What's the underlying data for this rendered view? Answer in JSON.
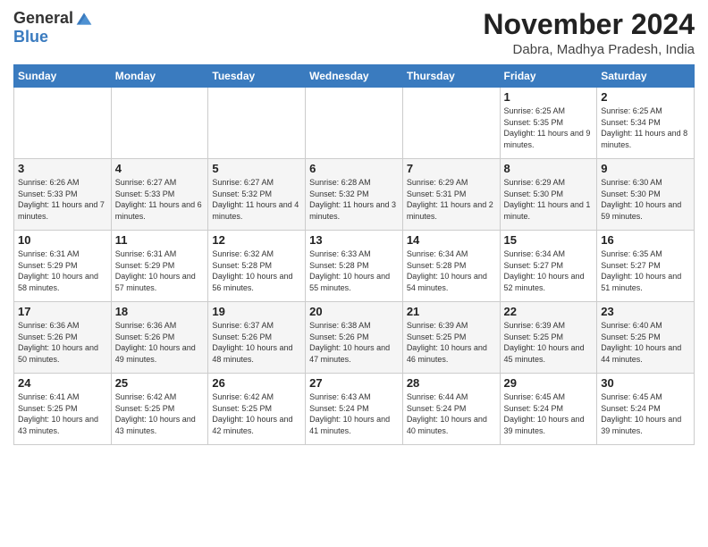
{
  "header": {
    "logo_general": "General",
    "logo_blue": "Blue",
    "month_year": "November 2024",
    "location": "Dabra, Madhya Pradesh, India"
  },
  "weekdays": [
    "Sunday",
    "Monday",
    "Tuesday",
    "Wednesday",
    "Thursday",
    "Friday",
    "Saturday"
  ],
  "weeks": [
    [
      {
        "day": "",
        "info": ""
      },
      {
        "day": "",
        "info": ""
      },
      {
        "day": "",
        "info": ""
      },
      {
        "day": "",
        "info": ""
      },
      {
        "day": "",
        "info": ""
      },
      {
        "day": "1",
        "info": "Sunrise: 6:25 AM\nSunset: 5:35 PM\nDaylight: 11 hours and 9 minutes."
      },
      {
        "day": "2",
        "info": "Sunrise: 6:25 AM\nSunset: 5:34 PM\nDaylight: 11 hours and 8 minutes."
      }
    ],
    [
      {
        "day": "3",
        "info": "Sunrise: 6:26 AM\nSunset: 5:33 PM\nDaylight: 11 hours and 7 minutes."
      },
      {
        "day": "4",
        "info": "Sunrise: 6:27 AM\nSunset: 5:33 PM\nDaylight: 11 hours and 6 minutes."
      },
      {
        "day": "5",
        "info": "Sunrise: 6:27 AM\nSunset: 5:32 PM\nDaylight: 11 hours and 4 minutes."
      },
      {
        "day": "6",
        "info": "Sunrise: 6:28 AM\nSunset: 5:32 PM\nDaylight: 11 hours and 3 minutes."
      },
      {
        "day": "7",
        "info": "Sunrise: 6:29 AM\nSunset: 5:31 PM\nDaylight: 11 hours and 2 minutes."
      },
      {
        "day": "8",
        "info": "Sunrise: 6:29 AM\nSunset: 5:30 PM\nDaylight: 11 hours and 1 minute."
      },
      {
        "day": "9",
        "info": "Sunrise: 6:30 AM\nSunset: 5:30 PM\nDaylight: 10 hours and 59 minutes."
      }
    ],
    [
      {
        "day": "10",
        "info": "Sunrise: 6:31 AM\nSunset: 5:29 PM\nDaylight: 10 hours and 58 minutes."
      },
      {
        "day": "11",
        "info": "Sunrise: 6:31 AM\nSunset: 5:29 PM\nDaylight: 10 hours and 57 minutes."
      },
      {
        "day": "12",
        "info": "Sunrise: 6:32 AM\nSunset: 5:28 PM\nDaylight: 10 hours and 56 minutes."
      },
      {
        "day": "13",
        "info": "Sunrise: 6:33 AM\nSunset: 5:28 PM\nDaylight: 10 hours and 55 minutes."
      },
      {
        "day": "14",
        "info": "Sunrise: 6:34 AM\nSunset: 5:28 PM\nDaylight: 10 hours and 54 minutes."
      },
      {
        "day": "15",
        "info": "Sunrise: 6:34 AM\nSunset: 5:27 PM\nDaylight: 10 hours and 52 minutes."
      },
      {
        "day": "16",
        "info": "Sunrise: 6:35 AM\nSunset: 5:27 PM\nDaylight: 10 hours and 51 minutes."
      }
    ],
    [
      {
        "day": "17",
        "info": "Sunrise: 6:36 AM\nSunset: 5:26 PM\nDaylight: 10 hours and 50 minutes."
      },
      {
        "day": "18",
        "info": "Sunrise: 6:36 AM\nSunset: 5:26 PM\nDaylight: 10 hours and 49 minutes."
      },
      {
        "day": "19",
        "info": "Sunrise: 6:37 AM\nSunset: 5:26 PM\nDaylight: 10 hours and 48 minutes."
      },
      {
        "day": "20",
        "info": "Sunrise: 6:38 AM\nSunset: 5:26 PM\nDaylight: 10 hours and 47 minutes."
      },
      {
        "day": "21",
        "info": "Sunrise: 6:39 AM\nSunset: 5:25 PM\nDaylight: 10 hours and 46 minutes."
      },
      {
        "day": "22",
        "info": "Sunrise: 6:39 AM\nSunset: 5:25 PM\nDaylight: 10 hours and 45 minutes."
      },
      {
        "day": "23",
        "info": "Sunrise: 6:40 AM\nSunset: 5:25 PM\nDaylight: 10 hours and 44 minutes."
      }
    ],
    [
      {
        "day": "24",
        "info": "Sunrise: 6:41 AM\nSunset: 5:25 PM\nDaylight: 10 hours and 43 minutes."
      },
      {
        "day": "25",
        "info": "Sunrise: 6:42 AM\nSunset: 5:25 PM\nDaylight: 10 hours and 43 minutes."
      },
      {
        "day": "26",
        "info": "Sunrise: 6:42 AM\nSunset: 5:25 PM\nDaylight: 10 hours and 42 minutes."
      },
      {
        "day": "27",
        "info": "Sunrise: 6:43 AM\nSunset: 5:24 PM\nDaylight: 10 hours and 41 minutes."
      },
      {
        "day": "28",
        "info": "Sunrise: 6:44 AM\nSunset: 5:24 PM\nDaylight: 10 hours and 40 minutes."
      },
      {
        "day": "29",
        "info": "Sunrise: 6:45 AM\nSunset: 5:24 PM\nDaylight: 10 hours and 39 minutes."
      },
      {
        "day": "30",
        "info": "Sunrise: 6:45 AM\nSunset: 5:24 PM\nDaylight: 10 hours and 39 minutes."
      }
    ]
  ]
}
